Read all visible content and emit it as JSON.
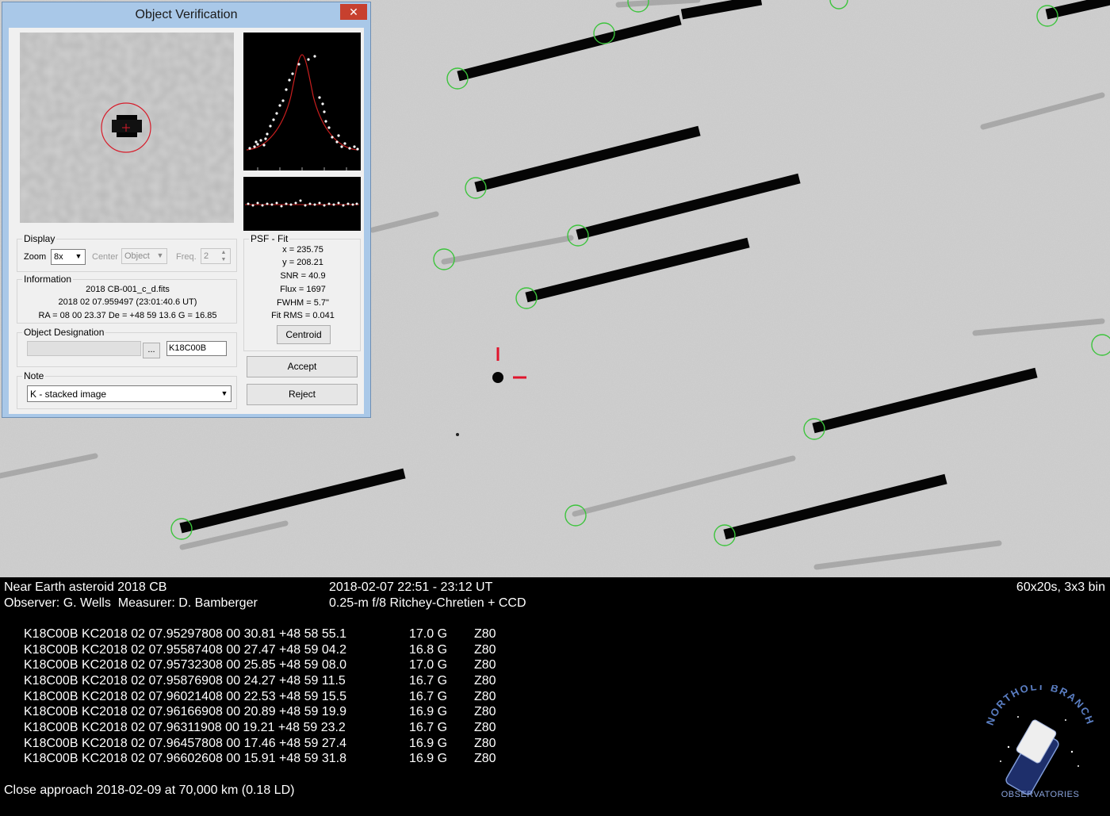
{
  "dialog": {
    "title": "Object Verification",
    "close_glyph": "✕",
    "display": {
      "legend": "Display",
      "zoom_label": "Zoom",
      "zoom_value": "8x",
      "center_label": "Center",
      "center_value": "Object",
      "freq_label": "Freq.",
      "freq_value": "2"
    },
    "information": {
      "legend": "Information",
      "file": "2018 CB-001_c_d.fits",
      "date": "2018 02 07.959497 (23:01:40.6 UT)",
      "coords": "RA = 08 00 23.37   De = +48 59 13.6   G = 16.85"
    },
    "designation": {
      "legend": "Object Designation",
      "browse_label": "...",
      "value": "K18C00B"
    },
    "note": {
      "legend": "Note",
      "value": "K - stacked image"
    },
    "psf": {
      "legend": "PSF - Fit",
      "x": "x = 235.75",
      "y": "y = 208.21",
      "snr": "SNR = 40.9",
      "flux": "Flux = 1697",
      "fwhm": "FWHM = 5.7\"",
      "fit_rms": "Fit RMS = 0.041",
      "centroid_label": "Centroid"
    },
    "accept_label": "Accept",
    "reject_label": "Reject"
  },
  "caption": {
    "object": "Near Earth asteroid 2018 CB",
    "observer": "Observer: G. Wells  Measurer: D. Bamberger",
    "time": "2018-02-07 22:51 - 23:12 UT",
    "telescope": "0.25-m f/8 Ritchey-Chretien + CCD",
    "exposure": "60x20s, 3x3 bin",
    "close_approach": "Close approach 2018-02-09 at 70,000 km (0.18 LD)"
  },
  "observations": [
    {
      "line": "K18C00B KC2018 02 07.95297808 00 30.81 +48 58 55.1",
      "mag": "17.0 G",
      "code": "Z80"
    },
    {
      "line": "K18C00B KC2018 02 07.95587408 00 27.47 +48 59 04.2",
      "mag": "16.8 G",
      "code": "Z80"
    },
    {
      "line": "K18C00B KC2018 02 07.95732308 00 25.85 +48 59 08.0",
      "mag": "17.0 G",
      "code": "Z80"
    },
    {
      "line": "K18C00B KC2018 02 07.95876908 00 24.27 +48 59 11.5",
      "mag": "16.7 G",
      "code": "Z80"
    },
    {
      "line": "K18C00B KC2018 02 07.96021408 00 22.53 +48 59 15.5",
      "mag": "16.7 G",
      "code": "Z80"
    },
    {
      "line": "K18C00B KC2018 02 07.96166908 00 20.89 +48 59 19.9",
      "mag": "16.9 G",
      "code": "Z80"
    },
    {
      "line": "K18C00B KC2018 02 07.96311908 00 19.21 +48 59 23.2",
      "mag": "16.7 G",
      "code": "Z80"
    },
    {
      "line": "K18C00B KC2018 02 07.96457808 00 17.46 +48 59 27.4",
      "mag": "16.9 G",
      "code": "Z80"
    },
    {
      "line": "K18C00B KC2018 02 07.96602608 00 15.91 +48 59 31.8",
      "mag": "16.9 G",
      "code": "Z80"
    }
  ],
  "logo": {
    "top_text": "NORTHOLT BRANCH",
    "bottom_text": "OBSERVATORIES"
  },
  "colors": {
    "sky": "#c9c9c9",
    "star_marker": "#3cc43c",
    "target_marker": "#e0142c",
    "dialog_frame": "#a9c8e8",
    "caption_bg": "#000000",
    "caption_text": "#ffffff"
  }
}
